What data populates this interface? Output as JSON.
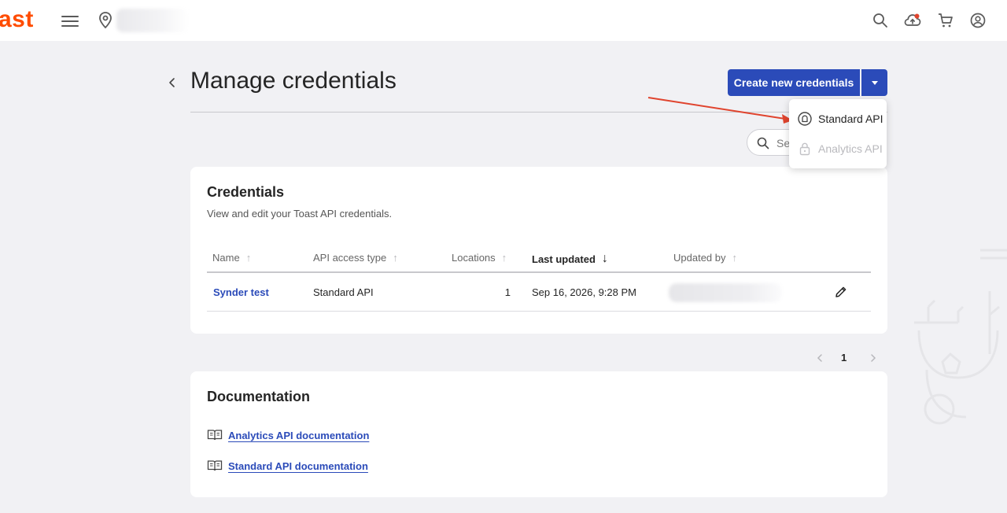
{
  "topbar": {
    "logo_text": "ast",
    "icons": [
      "search-icon",
      "cloud-upload-icon",
      "cart-icon",
      "account-icon"
    ]
  },
  "header": {
    "title": "Manage credentials",
    "create_button_label": "Create new credentials",
    "search_placeholder": "Search"
  },
  "dropdown": {
    "items": [
      {
        "label": "Standard API",
        "icon": "api-icon",
        "disabled": false
      },
      {
        "label": "Analytics API",
        "icon": "lock-icon",
        "disabled": true
      }
    ]
  },
  "credentials": {
    "title": "Credentials",
    "subtitle": "View and edit your Toast API credentials.",
    "columns": [
      {
        "label": "Name",
        "sort": "↑"
      },
      {
        "label": "API access type",
        "sort": "↑"
      },
      {
        "label": "Locations",
        "sort": "↑"
      },
      {
        "label": "Last updated",
        "sort": "↓"
      },
      {
        "label": "Updated by",
        "sort": "↑"
      }
    ],
    "rows": [
      {
        "name": "Synder test",
        "type": "Standard API",
        "locations": "1",
        "last_updated": "Sep 16, 2026, 9:28 PM"
      }
    ]
  },
  "pagination": {
    "current": "1"
  },
  "documentation": {
    "title": "Documentation",
    "links": [
      "Analytics API documentation",
      "Standard API documentation"
    ]
  },
  "colors": {
    "brand": "#ff4c00",
    "primary": "#2b4bb9",
    "annotation": "#e0442e"
  }
}
